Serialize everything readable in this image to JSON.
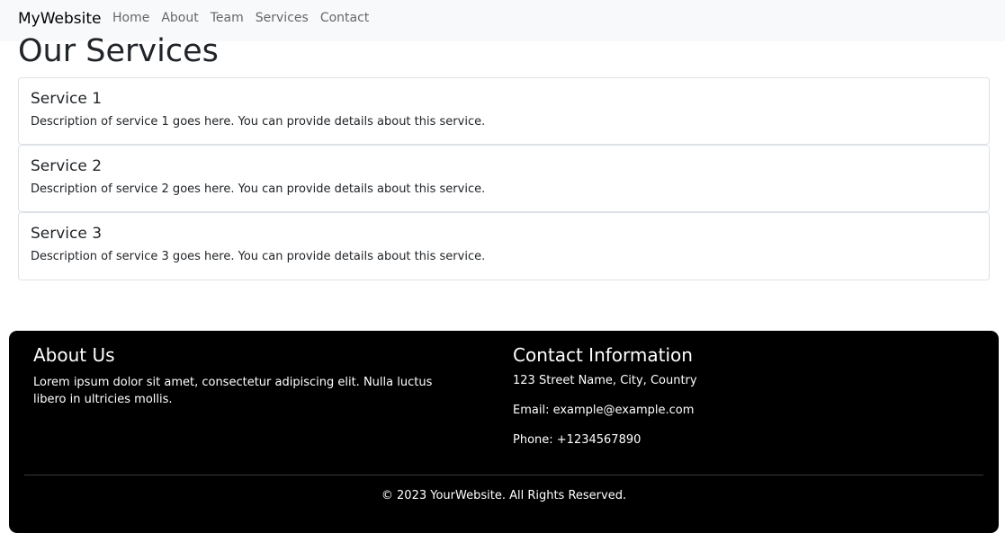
{
  "navbar": {
    "brand": "MyWebsite",
    "links": [
      "Home",
      "About",
      "Team",
      "Services",
      "Contact"
    ]
  },
  "main": {
    "title": "Our Services",
    "services": [
      {
        "title": "Service 1",
        "description": "Description of service 1 goes here. You can provide details about this service."
      },
      {
        "title": "Service 2",
        "description": "Description of service 2 goes here. You can provide details about this service."
      },
      {
        "title": "Service 3",
        "description": "Description of service 3 goes here. You can provide details about this service."
      }
    ]
  },
  "footer": {
    "about_title": "About Us",
    "about_text": "Lorem ipsum dolor sit amet, consectetur adipiscing elit. Nulla luctus libero in ultricies mollis.",
    "contact_title": "Contact Information",
    "address": "123 Street Name, City, Country",
    "email": "Email: example@example.com",
    "phone": "Phone: +1234567890",
    "copyright": "© 2023 YourWebsite. All Rights Reserved."
  },
  "colors": {
    "navbar_bg": "#f8f9fa",
    "footer_bg": "#000000",
    "border": "#dee2e6"
  }
}
